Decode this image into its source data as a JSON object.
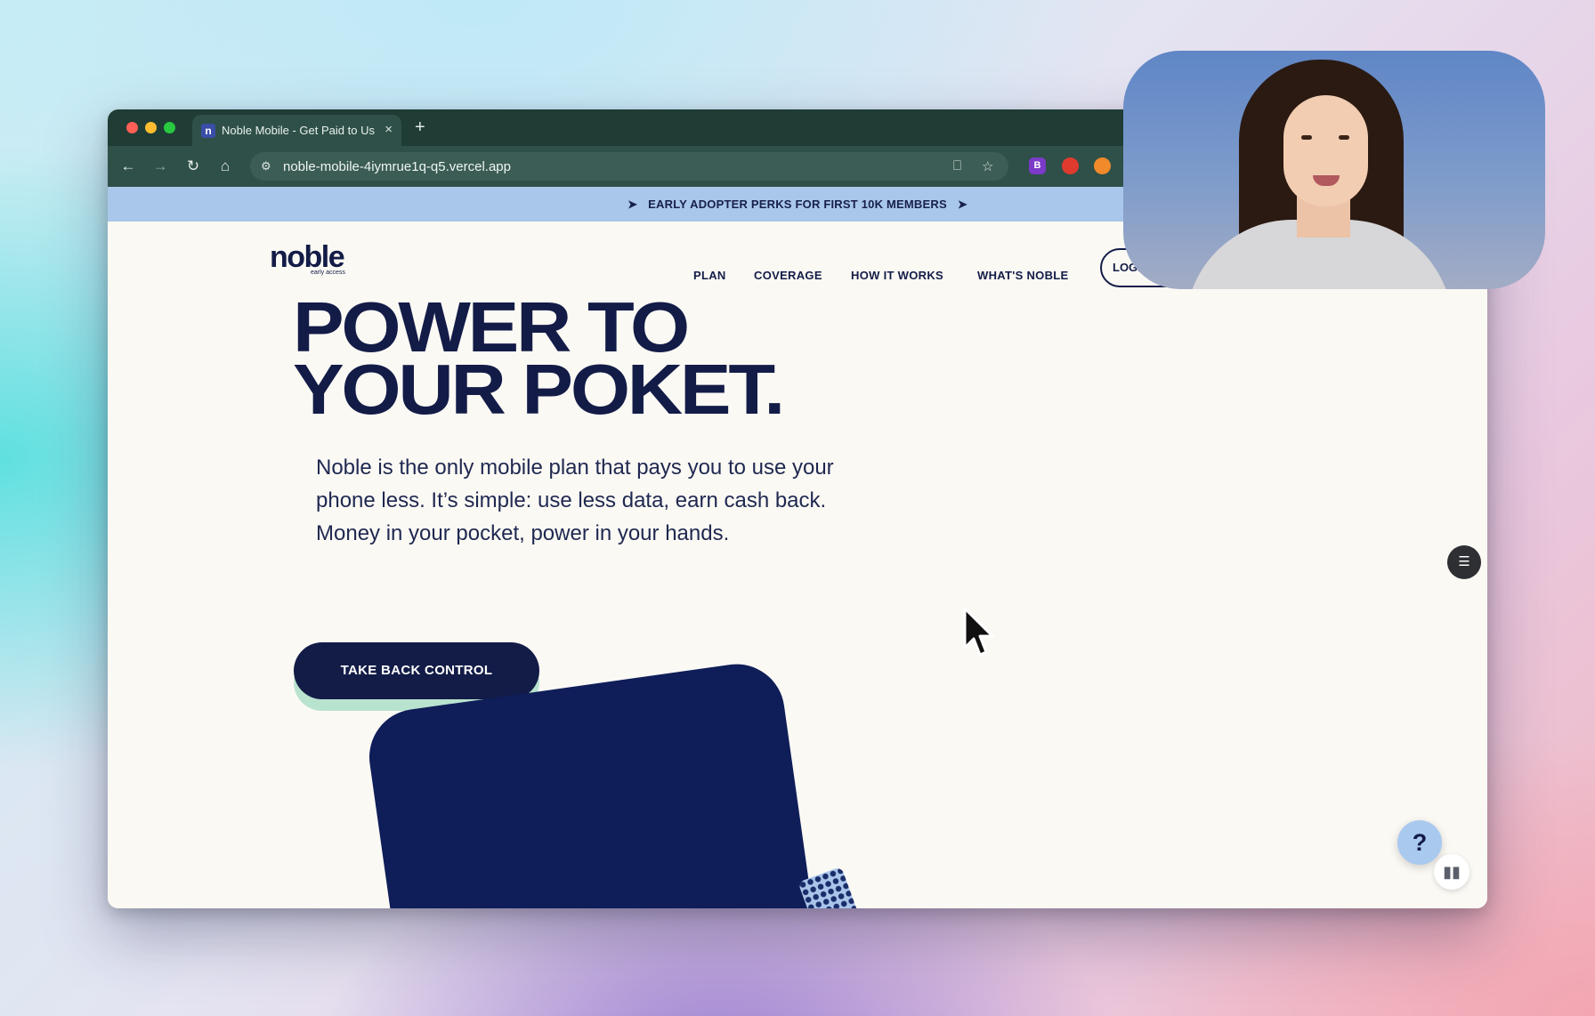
{
  "browser": {
    "tab_title": "Noble Mobile - Get Paid to Us",
    "tab_favicon": "n",
    "tab_close": "×",
    "new_tab": "+",
    "url": "noble-mobile-4iymrue1q-q5.vercel.app",
    "extension_badge": "B",
    "icons": [
      "back-arrow-icon",
      "forward-arrow-icon",
      "reload-icon",
      "home-icon",
      "site-info-icon",
      "install-app-icon",
      "bookmark-star-icon"
    ]
  },
  "page": {
    "banner_text": "EARLY ADOPTER PERKS FOR FIRST 10K MEMBERS",
    "logo_word": "noble",
    "logo_sub": "early access",
    "nav": {
      "plan": "PLAN",
      "coverage": "COVERAGE",
      "how_it_works": "HOW IT WORKS",
      "whats_noble": "WHAT'S NOBLE",
      "login": "LOGIN"
    },
    "headline_line1": "POWER TO",
    "headline_line2": "YOUR POKET.",
    "lede": "Noble is the only mobile plan that pays you to use your phone less. It’s simple: use less data, earn cash back. Money in your pocket, power in your hands.",
    "cta": "TAKE BACK CONTROL",
    "help": "?"
  },
  "colors": {
    "navy": "#131c47",
    "banner_blue": "#a8c7ea",
    "mint": "#b8e3cf",
    "chrome_green": "#2f5048"
  }
}
